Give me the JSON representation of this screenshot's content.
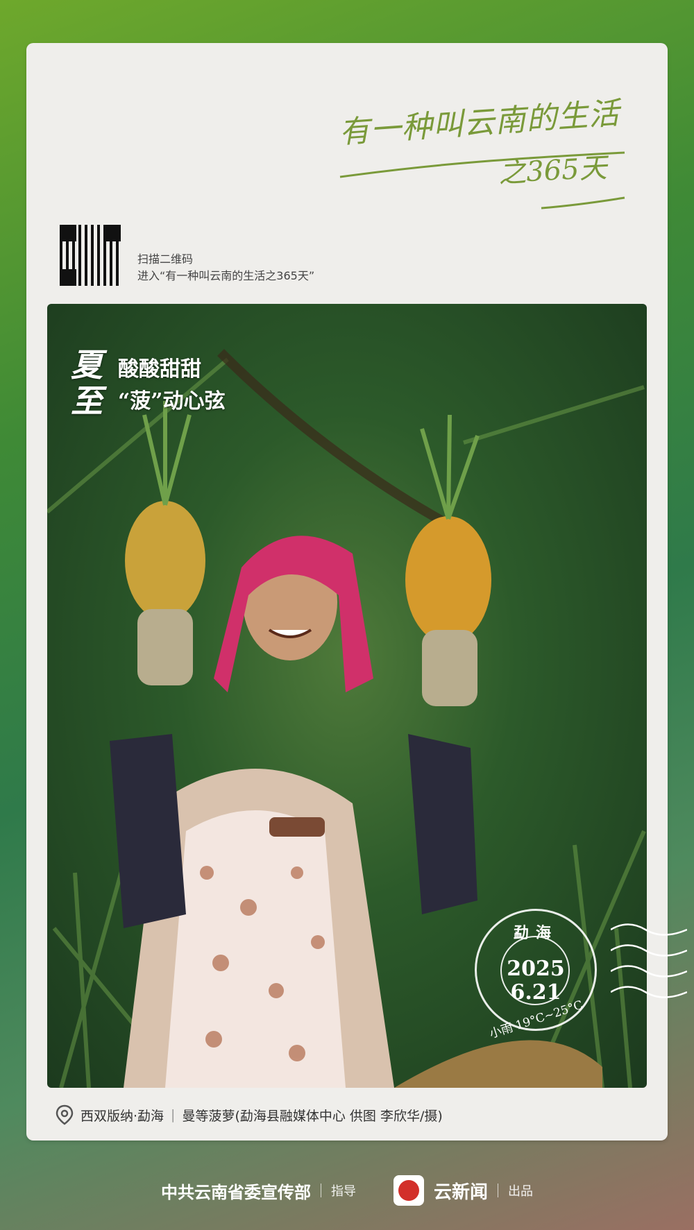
{
  "brand": {
    "title_line1": "有一种叫云南的生活",
    "title_line2": "之365天"
  },
  "qr": {
    "line1": "扫描二维码",
    "line2": "进入“有一种叫云南的生活之365天”"
  },
  "photo": {
    "solar_term": "夏至",
    "headline_line1": "酸酸甜甜",
    "headline_line2": "“菠”动心弦"
  },
  "stamp": {
    "place": "勐海",
    "year": "2025",
    "date": "6.21",
    "weather": "小雨 19°C~25°C"
  },
  "caption": {
    "location": "西双版纳·勐海",
    "text": "曼等菠萝(勐海县融媒体中心 供图  李欣华/摄)"
  },
  "footer": {
    "dept": "中共云南省委宣传部",
    "guide": "指导",
    "app": "云新闻",
    "produce": "出品"
  },
  "colors": {
    "brand_green": "#7a9a3a",
    "stamp_white": "#ffffff",
    "logo_red": "#d2302a"
  }
}
